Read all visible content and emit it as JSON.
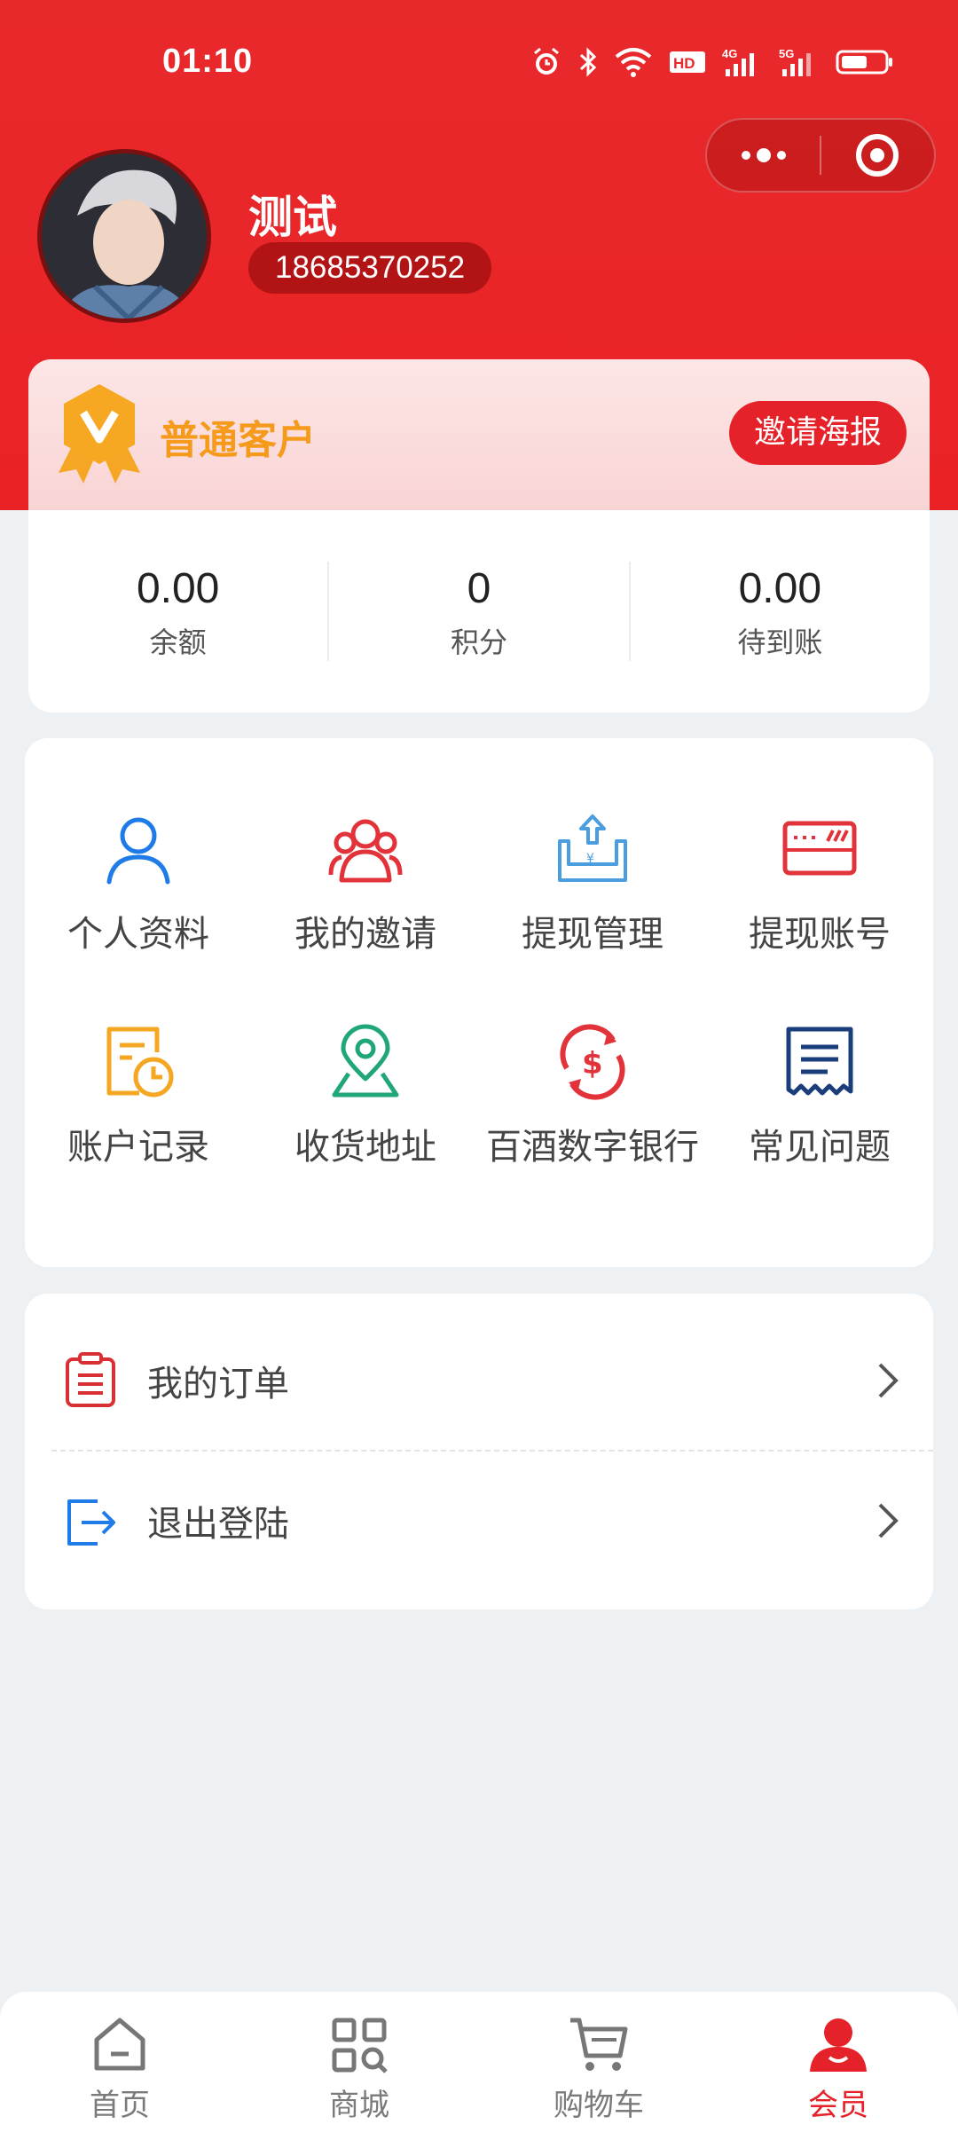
{
  "status_bar": {
    "time": "01:10",
    "network_4g": "4G",
    "network_5g": "5G",
    "hd_label": "HD"
  },
  "user": {
    "name": "测试",
    "phone": "18685370252"
  },
  "member": {
    "level": "普通客户",
    "invite_button": "邀请海报"
  },
  "stats": [
    {
      "value": "0.00",
      "label": "余额"
    },
    {
      "value": "0",
      "label": "积分"
    },
    {
      "value": "0.00",
      "label": "待到账"
    }
  ],
  "grid": [
    {
      "label": "个人资料",
      "icon": "user-icon",
      "color": "#1e7be8"
    },
    {
      "label": "我的邀请",
      "icon": "group-icon",
      "color": "#e2333a"
    },
    {
      "label": "提现管理",
      "icon": "withdraw-icon",
      "color": "#4a9ee0"
    },
    {
      "label": "提现账号",
      "icon": "card-icon",
      "color": "#e2333a"
    },
    {
      "label": "账户记录",
      "icon": "record-icon",
      "color": "#f5a623"
    },
    {
      "label": "收货地址",
      "icon": "location-icon",
      "color": "#21a67a"
    },
    {
      "label": "百酒数字银行",
      "icon": "exchange-icon",
      "color": "#e2333a"
    },
    {
      "label": "常见问题",
      "icon": "receipt-icon",
      "color": "#1a3d7c"
    }
  ],
  "list": [
    {
      "label": "我的订单",
      "icon": "order-icon"
    },
    {
      "label": "退出登陆",
      "icon": "logout-icon"
    }
  ],
  "tabs": [
    {
      "label": "首页",
      "icon": "home-icon"
    },
    {
      "label": "商城",
      "icon": "mall-icon"
    },
    {
      "label": "购物车",
      "icon": "cart-icon"
    },
    {
      "label": "会员",
      "icon": "member-icon",
      "active": true
    }
  ],
  "colors": {
    "primary": "#e52129",
    "gold": "#f59a1a",
    "background": "#eef1f4"
  }
}
